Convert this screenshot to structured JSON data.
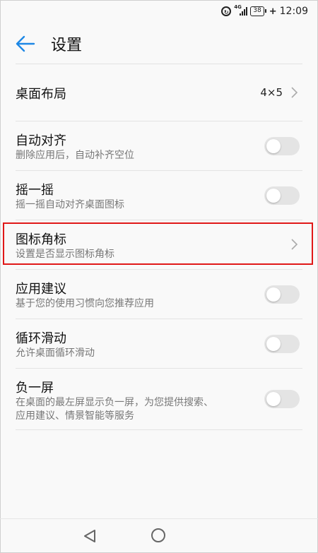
{
  "status_bar": {
    "battery": "38",
    "time": "12:09",
    "network": "4G"
  },
  "header": {
    "title": "设置"
  },
  "items": [
    {
      "title": "桌面布局",
      "subtitle": "",
      "value": "4×5",
      "control": "chevron"
    },
    {
      "title": "自动对齐",
      "subtitle": "删除应用后，自动补齐空位",
      "control": "switch-off"
    },
    {
      "title": "摇一摇",
      "subtitle": "摇一摇自动对齐桌面图标",
      "control": "switch-off"
    },
    {
      "title": "图标角标",
      "subtitle": "设置是否显示图标角标",
      "control": "chevron",
      "highlighted": true
    },
    {
      "title": "应用建议",
      "subtitle": "基于您的使用习惯向您推荐应用",
      "control": "switch-off"
    },
    {
      "title": "循环滑动",
      "subtitle": "允许桌面循环滑动",
      "control": "switch-off"
    },
    {
      "title": "负一屏",
      "subtitle_line1": "在桌面的最左屏显示负一屏，为您提供搜索、",
      "subtitle_line2": "应用建议、情景智能等服务",
      "control": "switch-off"
    }
  ],
  "colors": {
    "accent": "#1e88e5",
    "highlight_border": "#e01818",
    "switch_off": "#e4e4e4"
  }
}
